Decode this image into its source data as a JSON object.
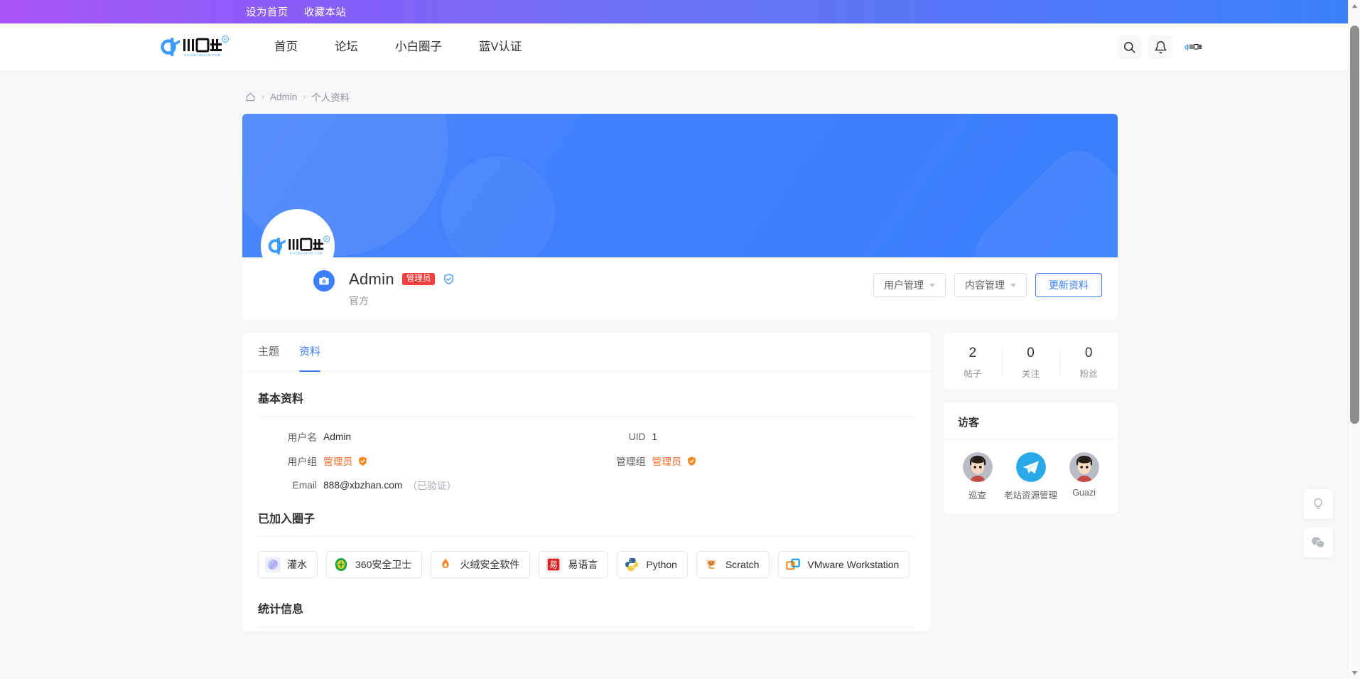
{
  "topbar": {
    "links": [
      {
        "label": "设为首页"
      },
      {
        "label": "收藏本站"
      }
    ]
  },
  "header": {
    "logo_text": "小白站",
    "logo_sub": "XIAOBAIZHAN.COM",
    "nav": [
      {
        "label": "首页"
      },
      {
        "label": "论坛"
      },
      {
        "label": "小白圈子"
      },
      {
        "label": "蓝V认证"
      }
    ],
    "search_icon": "search-icon",
    "bell_icon": "bell-icon",
    "avatar_alt": "小白站"
  },
  "breadcrumb": {
    "home_icon": "home-icon",
    "items": [
      {
        "label": "Admin"
      },
      {
        "label": "个人资料"
      }
    ],
    "separator": "›"
  },
  "profile": {
    "username": "Admin",
    "badge": "管理员",
    "verified_icon": "shield-check-icon",
    "subtitle": "官方",
    "camera_icon": "camera-icon",
    "actions": [
      {
        "label": "用户管理",
        "type": "dropdown"
      },
      {
        "label": "内容管理",
        "type": "dropdown"
      },
      {
        "label": "更新资料",
        "type": "primary"
      }
    ]
  },
  "tabs": [
    {
      "label": "主题",
      "active": false
    },
    {
      "label": "资料",
      "active": true
    }
  ],
  "basic_info": {
    "title": "基本资料",
    "rows": [
      {
        "label": "用户名",
        "value": "Admin",
        "style": "plain"
      },
      {
        "label": "UID",
        "value": "1",
        "style": "plain"
      },
      {
        "label": "用户组",
        "value": "管理员",
        "style": "orange",
        "icon": "shield-badge-icon"
      },
      {
        "label": "管理组",
        "value": "管理员",
        "style": "orange",
        "icon": "shield-badge-icon"
      },
      {
        "label": "Email",
        "value": "888@xbzhan.com",
        "note": "（已验证）",
        "style": "plain"
      }
    ]
  },
  "circles": {
    "title": "已加入圈子",
    "items": [
      {
        "label": "灌水",
        "icon": "gradient-blob-icon"
      },
      {
        "label": "360安全卫士",
        "icon": "360-shield-icon"
      },
      {
        "label": "火绒安全软件",
        "icon": "huorong-flame-icon"
      },
      {
        "label": "易语言",
        "icon": "epl-icon"
      },
      {
        "label": "Python",
        "icon": "python-icon"
      },
      {
        "label": "Scratch",
        "icon": "scratch-cat-icon"
      },
      {
        "label": "VMware Workstation",
        "icon": "vmware-icon"
      }
    ]
  },
  "statistics": {
    "title": "统计信息"
  },
  "sidebar": {
    "stats": [
      {
        "value": "2",
        "label": "帖子"
      },
      {
        "value": "0",
        "label": "关注"
      },
      {
        "value": "0",
        "label": "粉丝"
      }
    ],
    "visitors": {
      "title": "访客",
      "items": [
        {
          "name": "巡查",
          "avatar": "person-avatar"
        },
        {
          "name": "老站资源管理",
          "avatar": "telegram-icon"
        },
        {
          "name": "Guazi",
          "avatar": "person-avatar"
        }
      ]
    }
  },
  "rail": [
    {
      "icon": "lightbulb-icon"
    },
    {
      "icon": "wechat-icon"
    }
  ],
  "colors": {
    "accent": "#3b7ffd",
    "badge_red": "#f53f3f",
    "group_orange": "#f56c28",
    "topbar_from": "#a855f7",
    "topbar_to": "#3b82f6"
  }
}
